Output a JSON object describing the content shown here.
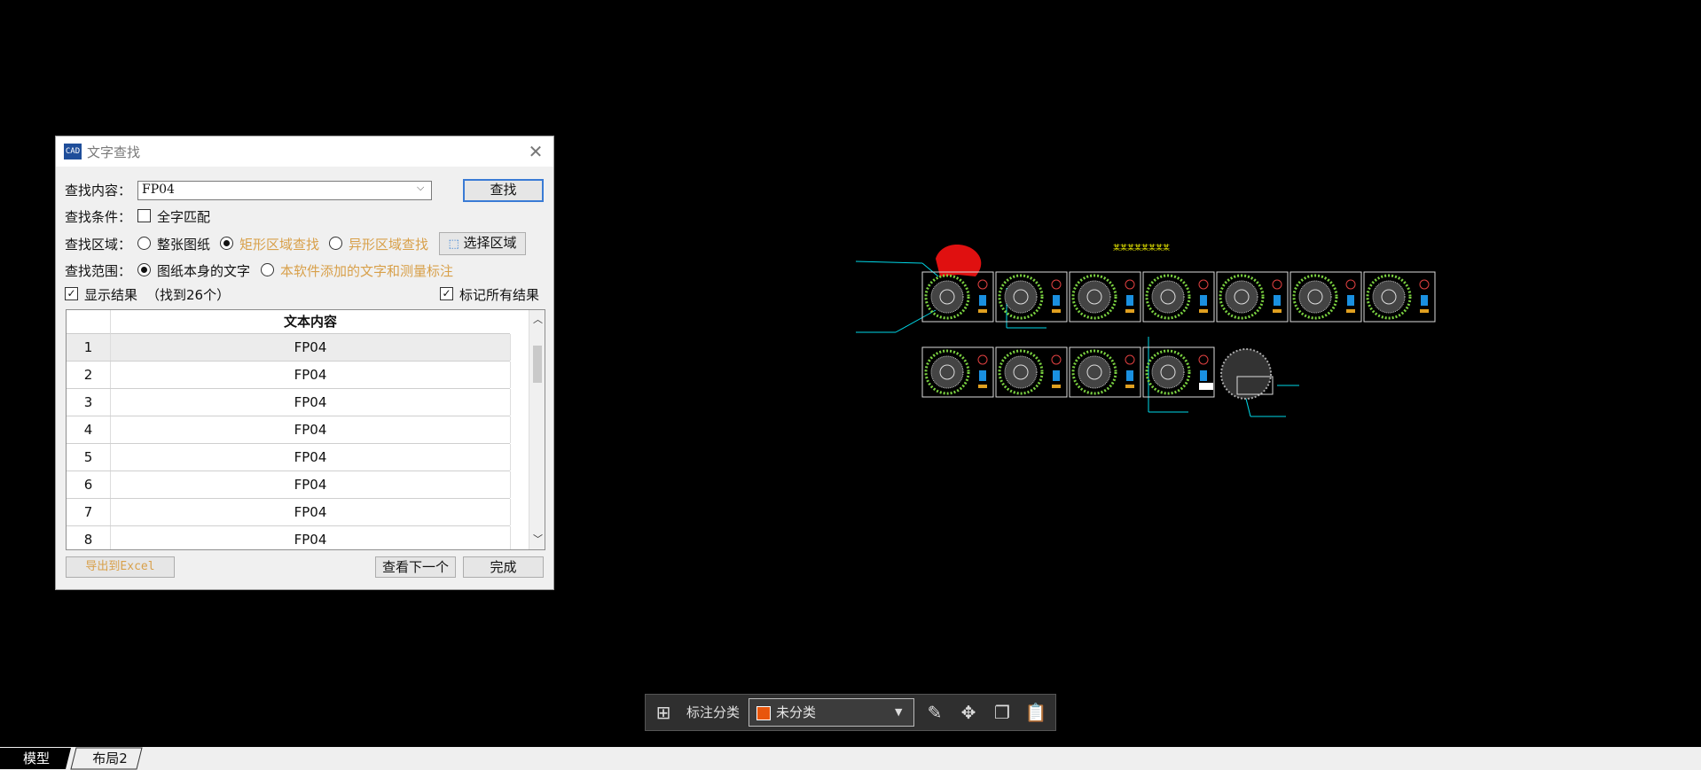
{
  "dialog": {
    "title": "文字查找",
    "app_icon_text": "CAD",
    "find_label": "查找内容：",
    "find_value": "FP04",
    "find_button": "查找",
    "condition_label": "查找条件：",
    "whole_word_label": "全字匹配",
    "area_label": "查找区域：",
    "area_options": [
      "整张图纸",
      "矩形区域查找",
      "异形区域查找"
    ],
    "select_area_button": "选择区域",
    "scope_label": "查找范围：",
    "scope_options": [
      "图纸本身的文字",
      "本软件添加的文字和测量标注"
    ],
    "show_results_label": "显示结果",
    "result_count": "（找到26个）",
    "mark_all_label": "标记所有结果",
    "table": {
      "header": "文本内容",
      "rows": [
        {
          "num": "1",
          "text": "FP04"
        },
        {
          "num": "2",
          "text": "FP04"
        },
        {
          "num": "3",
          "text": "FP04"
        },
        {
          "num": "4",
          "text": "FP04"
        },
        {
          "num": "5",
          "text": "FP04"
        },
        {
          "num": "6",
          "text": "FP04"
        },
        {
          "num": "7",
          "text": "FP04"
        },
        {
          "num": "8",
          "text": "FP04"
        }
      ]
    },
    "export_button": "导出到Excel",
    "next_button": "查看下一个",
    "done_button": "完成"
  },
  "drawing": {
    "sheet_title": "某某某某某某某某"
  },
  "toolbar": {
    "label": "标注分类",
    "category_value": "未分类",
    "category_color": "#e8560c"
  },
  "tabs": [
    "模型",
    "布局2"
  ]
}
